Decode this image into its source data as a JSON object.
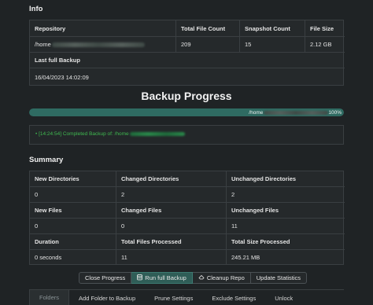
{
  "info": {
    "title": "Info",
    "headers": [
      "Repository",
      "Total File Count",
      "Snapshot Count",
      "File Size"
    ],
    "row": {
      "repository": "/home",
      "file_count": "209",
      "snapshot_count": "15",
      "file_size": "2.12 GB"
    },
    "last_backup_label": "Last full Backup",
    "last_backup_value": "16/04/2023 14:02:09"
  },
  "progress": {
    "title": "Backup Progress",
    "percent": 100,
    "path": "/home",
    "percent_label": "100%"
  },
  "log": {
    "bullet": "•",
    "timestamp": "[14:24:54]",
    "message": "Completed Backup of: /home"
  },
  "summary": {
    "title": "Summary",
    "rows": [
      {
        "labels": [
          "New Directories",
          "Changed Directories",
          "Unchanged Directories"
        ],
        "values": [
          "0",
          "2",
          "2"
        ]
      },
      {
        "labels": [
          "New Files",
          "Changed Files",
          "Unchanged Files"
        ],
        "values": [
          "0",
          "0",
          "11"
        ]
      },
      {
        "labels": [
          "Duration",
          "Total Files Processed",
          "Total Size Processed"
        ],
        "values": [
          "0 seconds",
          "11",
          "245.21 MB"
        ]
      }
    ]
  },
  "actions": {
    "close_progress": "Close Progress",
    "run_full_backup": "Run full Backup",
    "cleanup_repo": "Cleanup Repo",
    "update_statistics": "Update Statistics"
  },
  "tabs": [
    "Folders",
    "Add Folder to Backup",
    "Prune Settings",
    "Exclude Settings",
    "Unlock"
  ],
  "colors": {
    "background": "#1f2325",
    "accent": "#2f6b62",
    "log_text": "#3fb950"
  }
}
